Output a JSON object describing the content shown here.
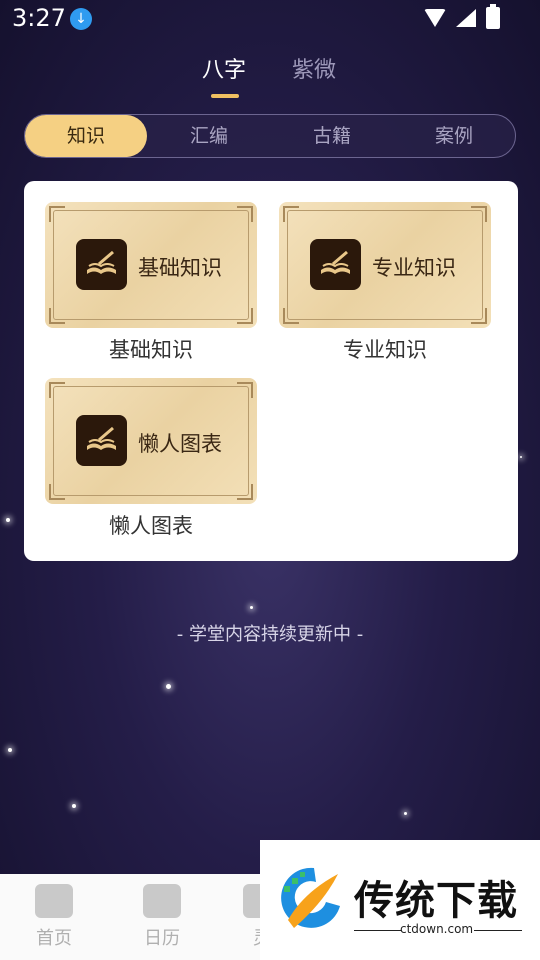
{
  "status": {
    "time": "3:27"
  },
  "top_tabs": [
    {
      "label": "八字",
      "active": true
    },
    {
      "label": "紫微",
      "active": false
    }
  ],
  "segments": [
    {
      "label": "知识",
      "active": true
    },
    {
      "label": "汇编",
      "active": false
    },
    {
      "label": "古籍",
      "active": false
    },
    {
      "label": "案例",
      "active": false
    }
  ],
  "tiles": [
    {
      "title": "基础知识",
      "caption": "基础知识"
    },
    {
      "title": "专业知识",
      "caption": "专业知识"
    },
    {
      "title": "懒人图表",
      "caption": "懒人图表"
    }
  ],
  "note": "- 学堂内容持续更新中 -",
  "bottom_nav": [
    {
      "label": "首页",
      "icon": "temple-icon"
    },
    {
      "label": "日历",
      "icon": "calendar-icon"
    },
    {
      "label": "灵",
      "icon": "person-icon"
    }
  ],
  "watermark": {
    "title": "传统下载",
    "subtitle": "ctdown.com"
  },
  "colors": {
    "accent": "#f5d083",
    "tab_underline": "#f0c061",
    "background": "#241d48"
  }
}
